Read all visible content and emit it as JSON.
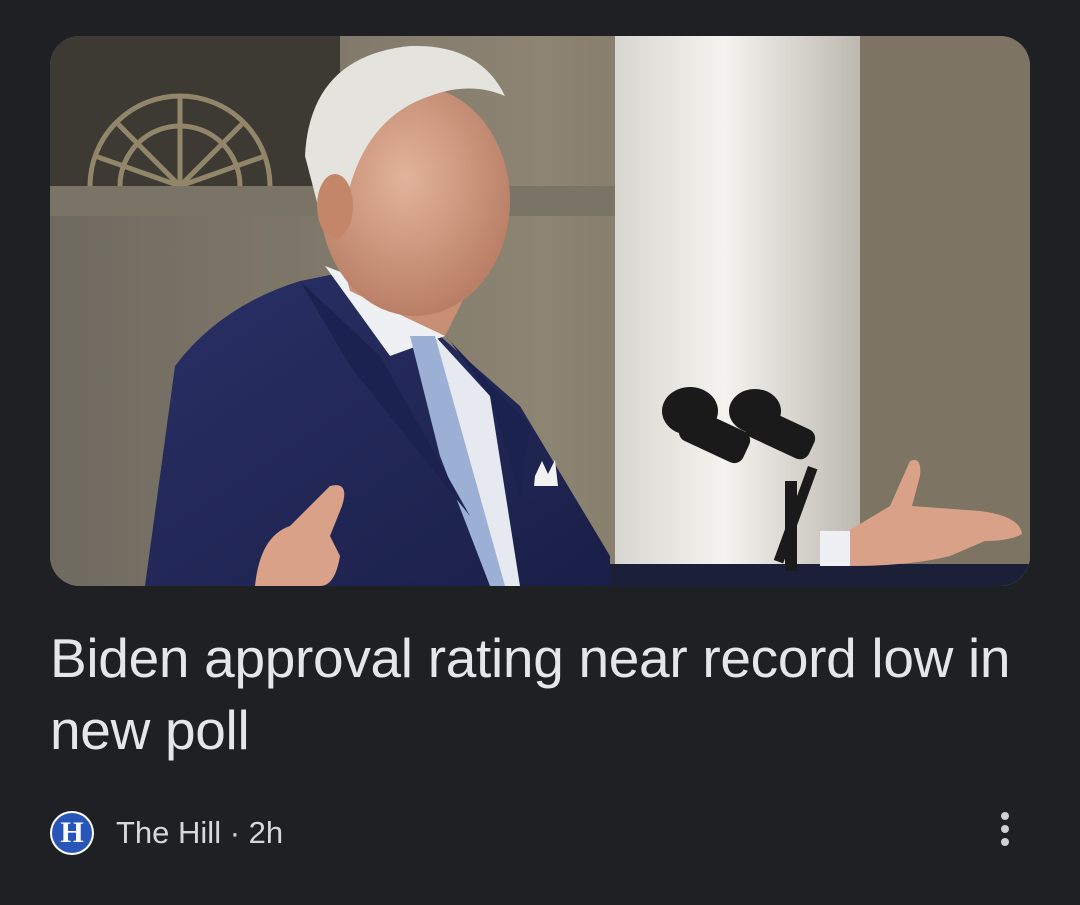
{
  "article": {
    "headline": "Biden approval rating near record low in new poll",
    "source": {
      "logo_letter": "H",
      "name": "The Hill",
      "separator": " · ",
      "age": "2h"
    }
  },
  "icons": {
    "more": "more-vert-icon"
  },
  "colors": {
    "background": "#1f2024",
    "headline_text": "#e6e6ea",
    "meta_text": "#d8d8dc",
    "source_logo_blue": "#2856b8"
  }
}
